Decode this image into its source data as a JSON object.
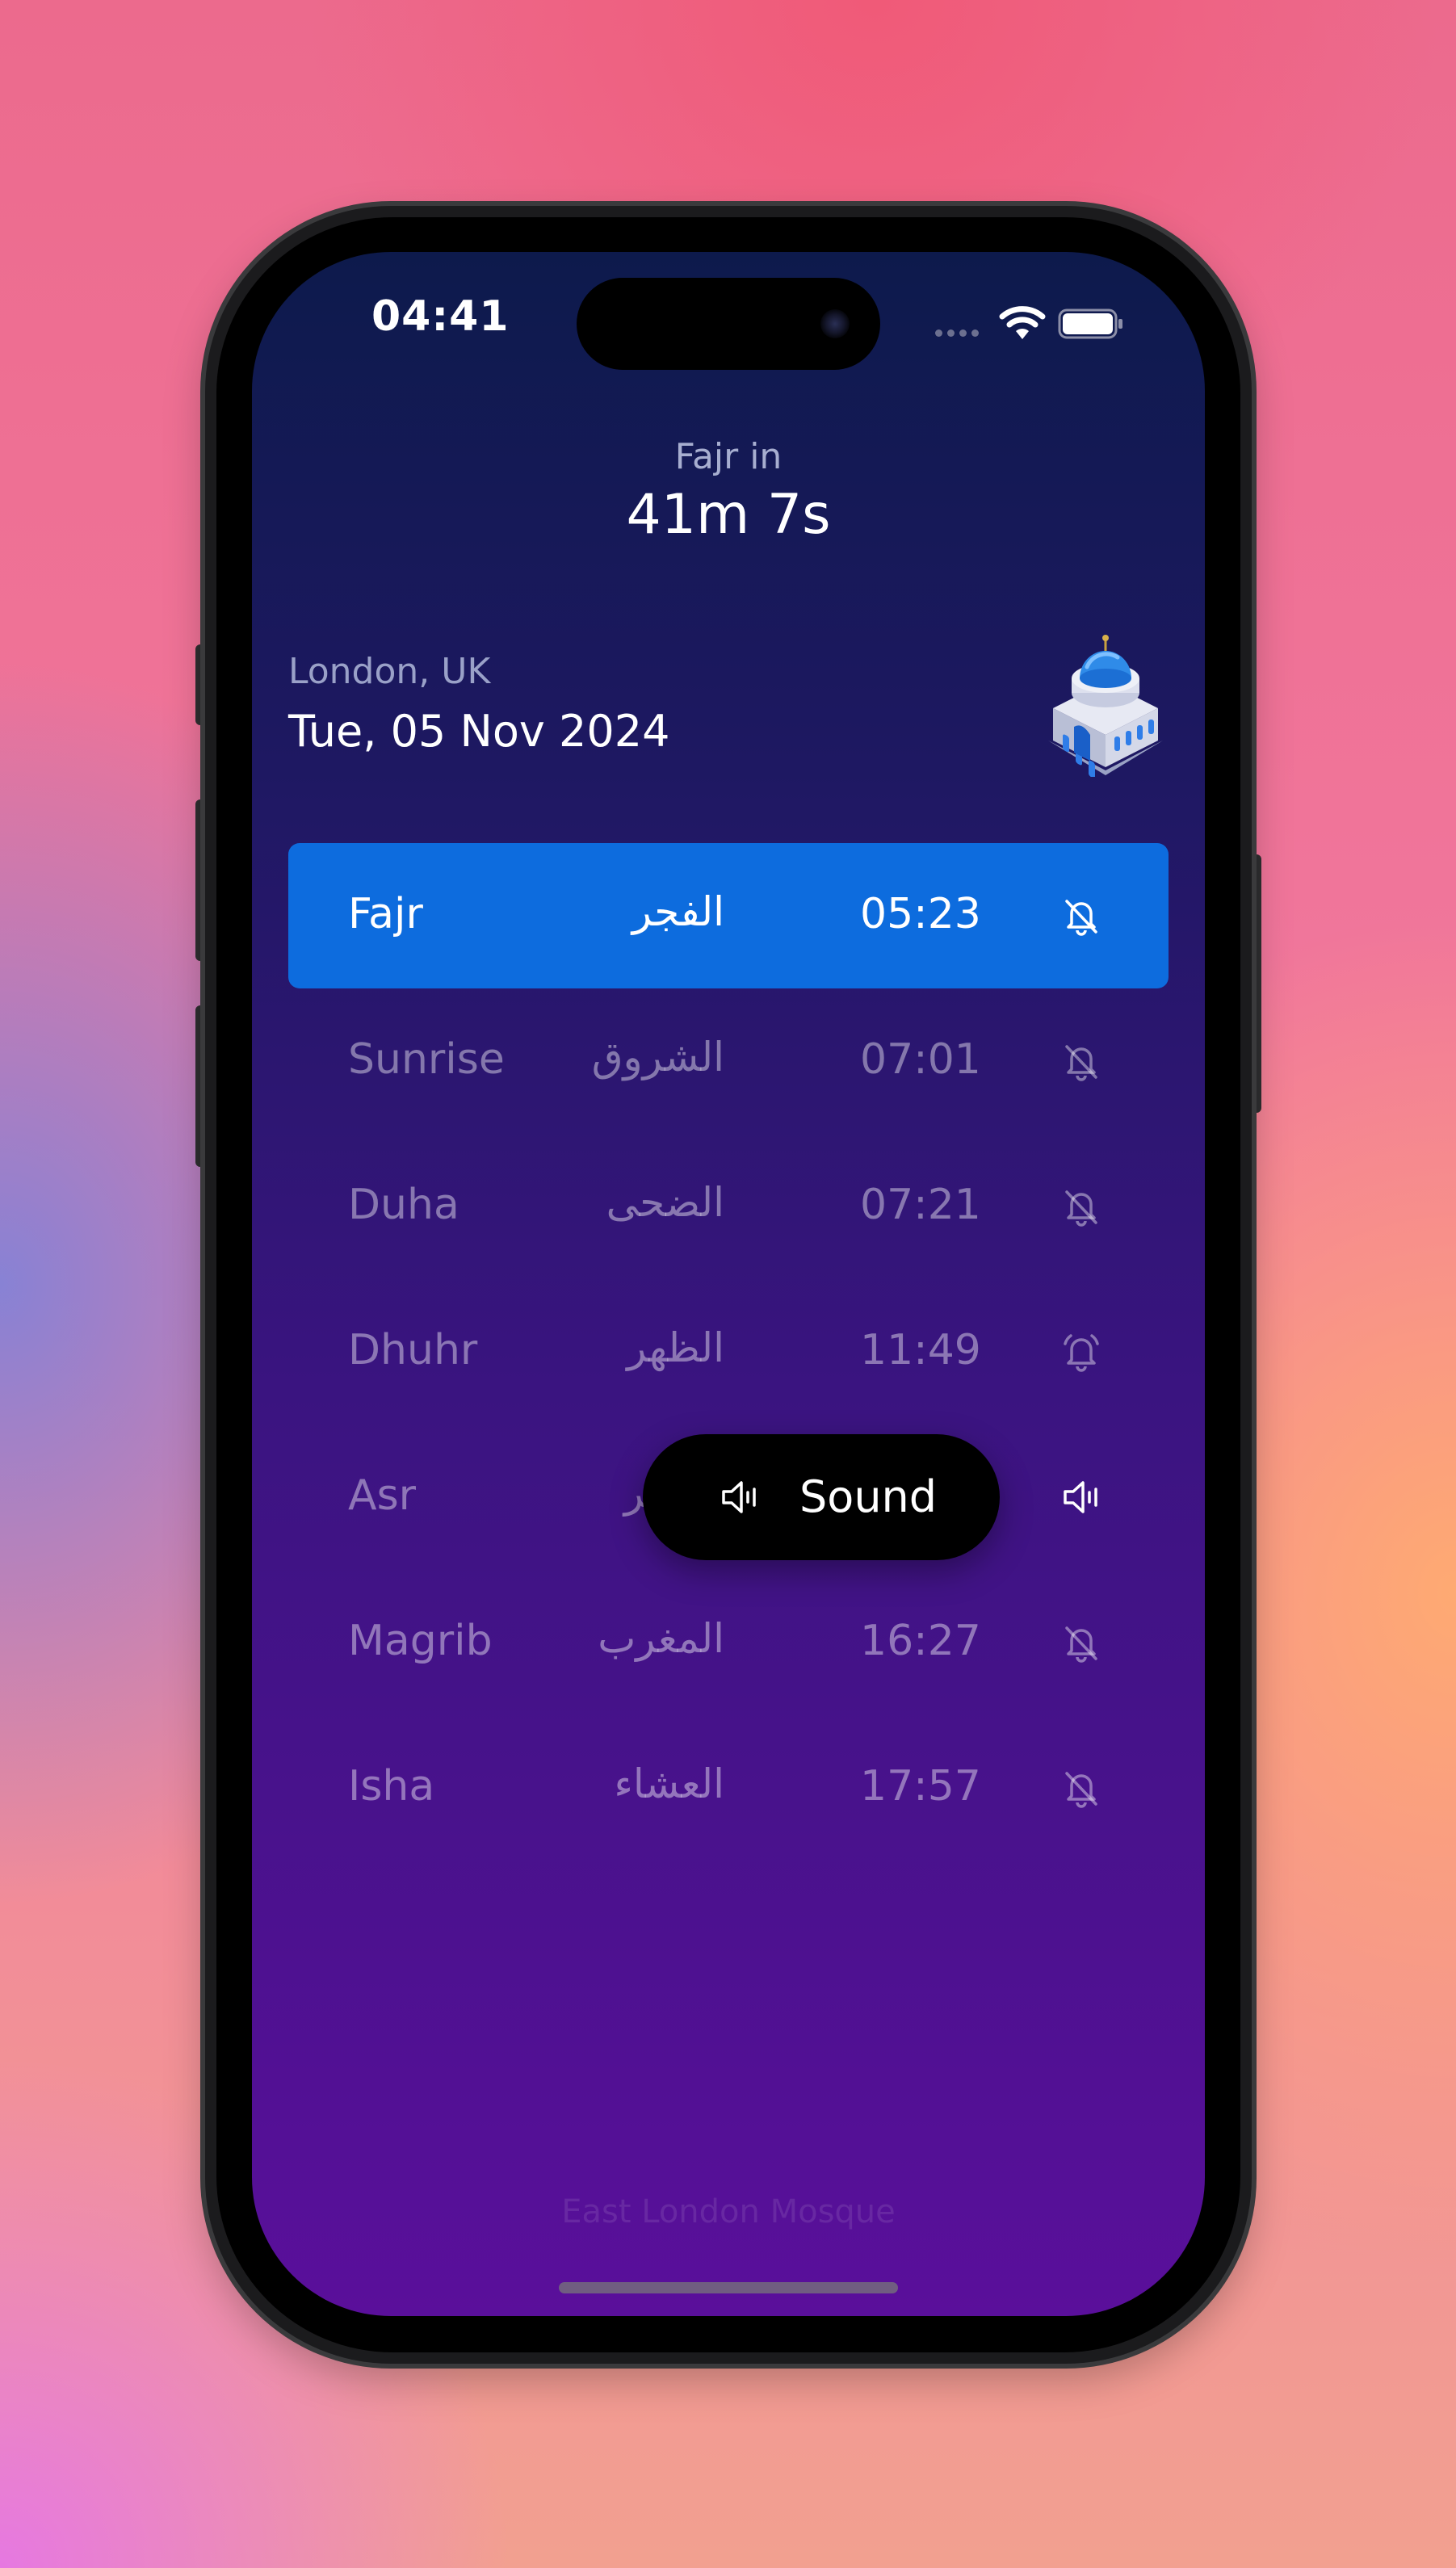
{
  "status_bar": {
    "time": "04:41"
  },
  "header": {
    "next_prayer_label": "Fajr in",
    "countdown": "41m 7s",
    "location": "London, UK",
    "date": "Tue, 05 Nov 2024"
  },
  "prayers": [
    {
      "name": "Fajr",
      "arabic": "الفجر",
      "time": "05:23",
      "alert_icon": "bell-off-icon",
      "active": true
    },
    {
      "name": "Sunrise",
      "arabic": "الشروق",
      "time": "07:01",
      "alert_icon": "bell-off-icon",
      "active": false
    },
    {
      "name": "Duha",
      "arabic": "الضحى",
      "time": "07:21",
      "alert_icon": "bell-off-icon",
      "active": false
    },
    {
      "name": "Dhuhr",
      "arabic": "الظهر",
      "time": "11:49",
      "alert_icon": "bell-icon",
      "active": false
    },
    {
      "name": "Asr",
      "arabic": "العصر",
      "time": "",
      "alert_icon": "speaker-icon",
      "active": false
    },
    {
      "name": "Magrib",
      "arabic": "المغرب",
      "time": "16:27",
      "alert_icon": "bell-off-icon",
      "active": false
    },
    {
      "name": "Isha",
      "arabic": "العشاء",
      "time": "17:57",
      "alert_icon": "bell-off-icon",
      "active": false
    }
  ],
  "toast": {
    "label": "Sound",
    "icon": "speaker-icon"
  },
  "footer": {
    "mosque_name": "East London Mosque"
  },
  "colors": {
    "active_row": "#0d6cde",
    "gradient_top": "#0d1a4c",
    "gradient_bottom": "#5a0f9b"
  }
}
